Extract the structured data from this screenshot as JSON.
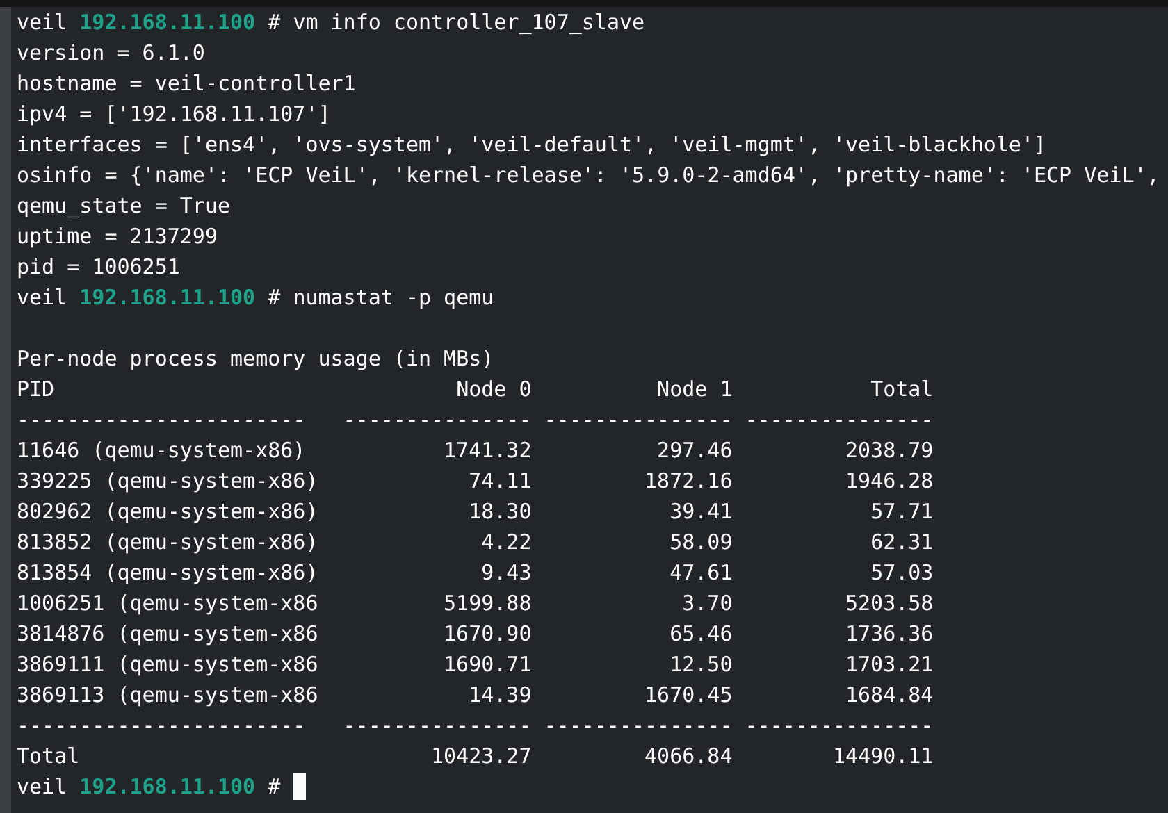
{
  "terminal": {
    "lines": [
      {
        "kind": "prompt",
        "user": "veil",
        "host": "192.168.11.100",
        "symbol": "#",
        "command": "vm info controller_107_slave",
        "cursor": false
      },
      {
        "kind": "output",
        "text": "version = 6.1.0"
      },
      {
        "kind": "output",
        "text": "hostname = veil-controller1"
      },
      {
        "kind": "output",
        "text": "ipv4 = ['192.168.11.107']"
      },
      {
        "kind": "output",
        "text": "interfaces = ['ens4', 'ovs-system', 'veil-default', 'veil-mgmt', 'veil-blackhole']"
      },
      {
        "kind": "output",
        "text": "osinfo = {'name': 'ECP VeiL', 'kernel-release': '5.9.0-2-amd64', 'pretty-name': 'ECP VeiL',"
      },
      {
        "kind": "output",
        "text": "qemu_state = True"
      },
      {
        "kind": "output",
        "text": "uptime = 2137299"
      },
      {
        "kind": "output",
        "text": "pid = 1006251"
      },
      {
        "kind": "prompt",
        "user": "veil",
        "host": "192.168.11.100",
        "symbol": "#",
        "command": "numastat -p qemu",
        "cursor": false
      },
      {
        "kind": "blank"
      },
      {
        "kind": "output",
        "text": "Per-node process memory usage (in MBs)"
      },
      {
        "kind": "header",
        "cells": [
          "PID",
          "Node 0",
          "Node 1",
          "Total"
        ]
      },
      {
        "kind": "rule",
        "cells": [
          "-----------------------",
          "---------------",
          "---------------",
          "---------------"
        ]
      },
      {
        "kind": "row",
        "cells": [
          "11646 (qemu-system-x86)",
          "1741.32",
          "297.46",
          "2038.79"
        ]
      },
      {
        "kind": "row",
        "cells": [
          "339225 (qemu-system-x86)",
          "74.11",
          "1872.16",
          "1946.28"
        ]
      },
      {
        "kind": "row",
        "cells": [
          "802962 (qemu-system-x86)",
          "18.30",
          "39.41",
          "57.71"
        ]
      },
      {
        "kind": "row",
        "cells": [
          "813852 (qemu-system-x86)",
          "4.22",
          "58.09",
          "62.31"
        ]
      },
      {
        "kind": "row",
        "cells": [
          "813854 (qemu-system-x86)",
          "9.43",
          "47.61",
          "57.03"
        ]
      },
      {
        "kind": "row",
        "cells": [
          "1006251 (qemu-system-x86",
          "5199.88",
          "3.70",
          "5203.58"
        ]
      },
      {
        "kind": "row",
        "cells": [
          "3814876 (qemu-system-x86",
          "1670.90",
          "65.46",
          "1736.36"
        ]
      },
      {
        "kind": "row",
        "cells": [
          "3869111 (qemu-system-x86",
          "1690.71",
          "12.50",
          "1703.21"
        ]
      },
      {
        "kind": "row",
        "cells": [
          "3869113 (qemu-system-x86",
          "14.39",
          "1670.45",
          "1684.84"
        ]
      },
      {
        "kind": "rule",
        "cells": [
          "-----------------------",
          "---------------",
          "---------------",
          "---------------"
        ]
      },
      {
        "kind": "row",
        "cells": [
          "Total",
          "10423.27",
          "4066.84",
          "14490.11"
        ]
      },
      {
        "kind": "prompt",
        "user": "veil",
        "host": "192.168.11.100",
        "symbol": "#",
        "cursor": true
      }
    ]
  }
}
